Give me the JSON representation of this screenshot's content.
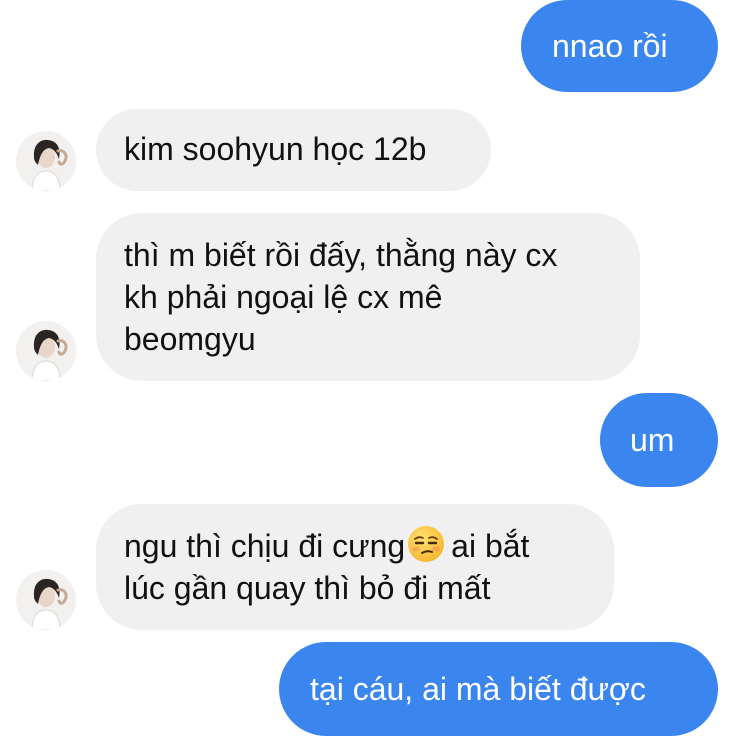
{
  "messages": [
    {
      "side": "outgoing",
      "lines": [
        "nnao rồi"
      ]
    },
    {
      "side": "incoming",
      "lines": [
        "kim soohyun học 12b"
      ]
    },
    {
      "side": "incoming",
      "lines": [
        "thì m biết rồi đấy, thằng này cx",
        "kh phải ngoại lệ cx mê",
        "beomgyu"
      ]
    },
    {
      "side": "outgoing",
      "lines": [
        "um"
      ]
    },
    {
      "side": "incoming",
      "line1_before": "ngu thì chịu đi cưng",
      "line1_emoji": "unamused-face-emoji",
      "line1_after": "ai bắt",
      "line2": "lúc gần quay thì bỏ đi mất"
    },
    {
      "side": "outgoing",
      "lines": [
        "tại cáu, ai mà biết được"
      ]
    }
  ],
  "colors": {
    "outgoing_bubble": "#3b86ee",
    "incoming_bubble": "#f0f0f0",
    "outgoing_text": "#ffffff",
    "incoming_text": "#111111"
  },
  "icons": {
    "avatar": "contact-avatar",
    "emoji": "unamused-face-emoji"
  }
}
